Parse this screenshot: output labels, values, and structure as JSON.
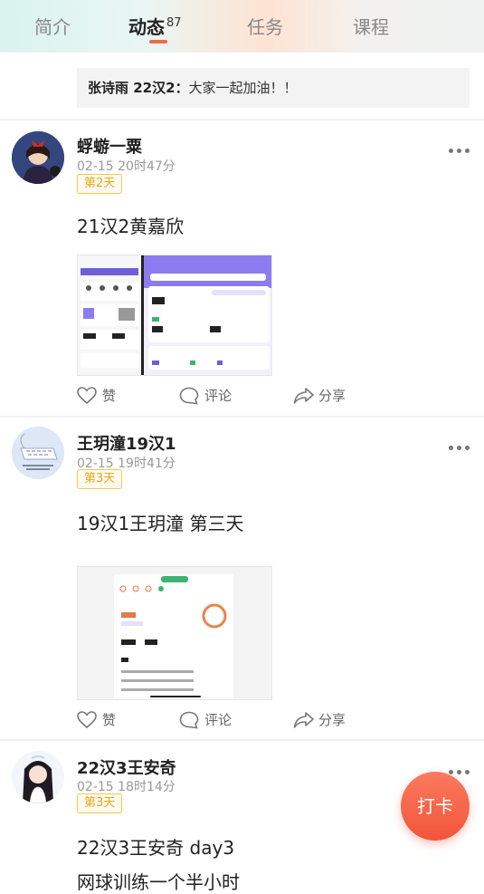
{
  "tabs": [
    {
      "label": "简介"
    },
    {
      "label": "动态",
      "count": "87"
    },
    {
      "label": "任务"
    },
    {
      "label": "课程"
    }
  ],
  "comment_preview": {
    "author": "张诗雨 22汉2：",
    "text": "大家一起加油！！"
  },
  "posts": [
    {
      "name": "蜉蝣一粟",
      "time": "02-15 20时47分",
      "day_badge": "第2天",
      "text": "21汉2黄嘉欣"
    },
    {
      "name": "王玥潼19汉1",
      "time": "02-15 19时41分",
      "day_badge": "第3天",
      "text": "19汉1王玥潼 第三天"
    },
    {
      "name": "22汉3王安奇",
      "time": "02-15 18时14分",
      "day_badge": "第3天",
      "text": "22汉3王安奇 day3",
      "text2": "网球训练一个半小时"
    }
  ],
  "actions": {
    "like": "赞",
    "comment": "评论",
    "share": "分享"
  },
  "fab": {
    "label": "打卡"
  },
  "colors": {
    "accent": "#f06a4a",
    "badge": "#e6a817",
    "purple": "#8b7cf0"
  }
}
